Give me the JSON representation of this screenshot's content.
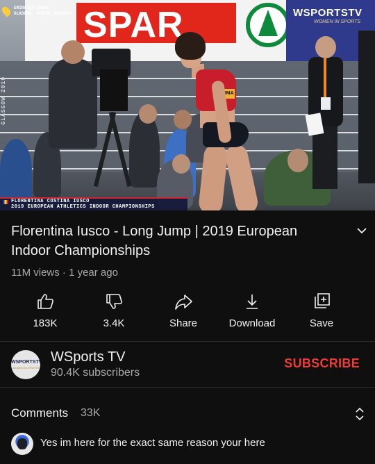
{
  "video": {
    "location_line1": "EMIRATES ARENA",
    "location_line2": "GLASGOW, UNITED KINGDOM",
    "vertical_text": "GLASGOW 2019",
    "banner_text": "SPAR",
    "channel_logo": "WSPORTSTV",
    "channel_logo_tagline": "WOMEN IN SPORTS",
    "athlete_bib": "ROMA",
    "lower_third_name": "FLORENTINA COSTINA IUSCO",
    "lower_third_event": "2019 EUROPEAN ATHLETICS INDOOR CHAMPIONSHIPS",
    "colors": {
      "banner_red": "#e1261c",
      "banner_green": "#0f8a3c",
      "lower_third_bg": "#141838",
      "lower_third_accent": "#d4242f"
    }
  },
  "info": {
    "title": "Florentina Iusco - Long Jump | 2019 European Indoor Championships",
    "meta": "11M views · 1 year ago",
    "expand_icon": "chevron-down-icon"
  },
  "actions": [
    {
      "icon": "thumbs-up-icon",
      "label": "183K"
    },
    {
      "icon": "thumbs-down-icon",
      "label": "3.4K"
    },
    {
      "icon": "share-icon",
      "label": "Share"
    },
    {
      "icon": "download-icon",
      "label": "Download"
    },
    {
      "icon": "save-icon",
      "label": "Save"
    }
  ],
  "channel": {
    "name": "WSports TV",
    "subscribers": "90.4K subscribers",
    "subscribe_label": "SUBSCRIBE",
    "avatar_text": "WSPORTSTV",
    "avatar_subtext": "WOMEN IN SPORTS",
    "subscribe_color": "#ef3b33"
  },
  "comments": {
    "label": "Comments",
    "count": "33K",
    "sort_icon": "unfold-icon",
    "first": "Yes im here for the exact same reason your here"
  }
}
